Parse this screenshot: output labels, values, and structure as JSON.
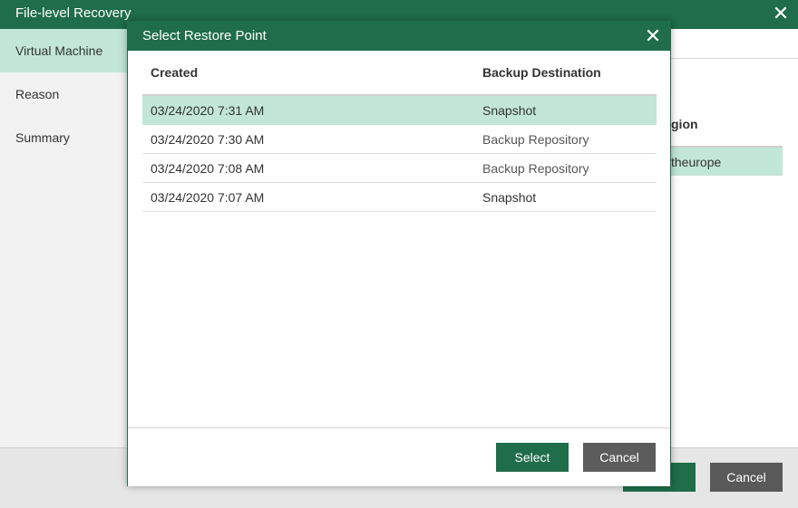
{
  "window": {
    "title": "File-level Recovery",
    "close_glyph": "✕"
  },
  "sidebar": {
    "items": [
      {
        "label": "Virtual Machine",
        "active": true
      },
      {
        "label": "Reason",
        "active": false
      },
      {
        "label": "Summary",
        "active": false
      }
    ]
  },
  "background": {
    "region_label": "gion",
    "region_value": "theurope",
    "next_label": "",
    "cancel_label": "Cancel"
  },
  "dialog": {
    "title": "Select Restore Point",
    "close_glyph": "✕",
    "columns": [
      "Created",
      "Backup Destination"
    ],
    "rows": [
      {
        "created": "03/24/2020 7:31 AM",
        "destination": "Snapshot",
        "selected": true
      },
      {
        "created": "03/24/2020 7:30 AM",
        "destination": "Backup Repository",
        "selected": false
      },
      {
        "created": "03/24/2020 7:08 AM",
        "destination": "Backup Repository",
        "selected": false
      },
      {
        "created": "03/24/2020 7:07 AM",
        "destination": "Snapshot",
        "selected": false
      }
    ],
    "select_label": "Select",
    "cancel_label": "Cancel"
  },
  "colors": {
    "brand_green": "#1f6d4a",
    "selection": "#c2e6d7",
    "button_grey": "#595959"
  }
}
